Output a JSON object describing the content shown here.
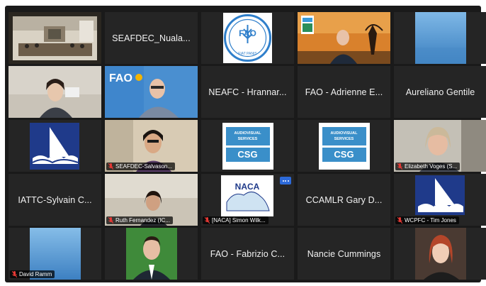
{
  "tiles": {
    "r1c2": "SEAFDEC_Nuala...",
    "r2c3": "NEAFC - Hrannar...",
    "r2c4": "FAO - Adrienne E...",
    "r2c5": "Aureliano Gentile",
    "r3c2": "SEAFDEC-Salvason...",
    "r3c5": "Elizabeth Voges (S...",
    "r4c1": "IATTC-Sylvain C...",
    "r4c2": "Ruth Fernandez (IC...",
    "r4c3": "[NACA] Simon Wilk...",
    "r4c4": "CCAMLR Gary D...",
    "r4c5": "WCPFC - Tim Jones",
    "r5c1": "David Ramm",
    "r5c3": "FAO - Fabrizio C...",
    "r5c4": "Nancie Cummings"
  },
  "logos": {
    "fao_text": "FAO",
    "fiat_panis": "FIAT PANIS",
    "csg_top": "AUDIOVISUAL SERVICES",
    "csg_bottom": "CSG",
    "naca_text": "NACA"
  },
  "colors": {
    "active_speaker": "#5fc23f",
    "fao_blue": "#2f7fcb",
    "muted_mic": "#e53935"
  }
}
